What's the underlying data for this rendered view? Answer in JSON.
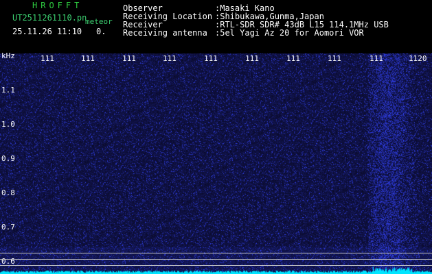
{
  "header": {
    "brand": "HROFFT",
    "filename": "UT2511261110.pn",
    "file_suffix": "meteor",
    "datetime": "25.11.26 11:10",
    "counter": "0.",
    "fields": [
      {
        "label": "Observer",
        "value": ":Masaki Kano"
      },
      {
        "label": "Receiving Location",
        "value": ":Shibukawa,Gunma,Japan"
      },
      {
        "label": "Receiver",
        "value": ":RTL-SDR SDR# 43dB L15 114.1MHz USB"
      },
      {
        "label": "Receiving antenna",
        "value": ":5el Yagi Az 20 for Aomori VOR"
      }
    ]
  },
  "axis": {
    "y_unit": "kHz",
    "y_ticks": [
      "1.1",
      "1.0",
      "0.9",
      "0.8",
      "0.7",
      "0.6"
    ],
    "x_ticks": [
      "111",
      "111",
      "111",
      "111",
      "111",
      "111",
      "111",
      "111",
      "111",
      "1120"
    ]
  },
  "colors": {
    "background": "#000000",
    "noise_dark": "#0a0a3a",
    "noise_blue": "#2b3bd0",
    "trace": "#00e5ff"
  }
}
